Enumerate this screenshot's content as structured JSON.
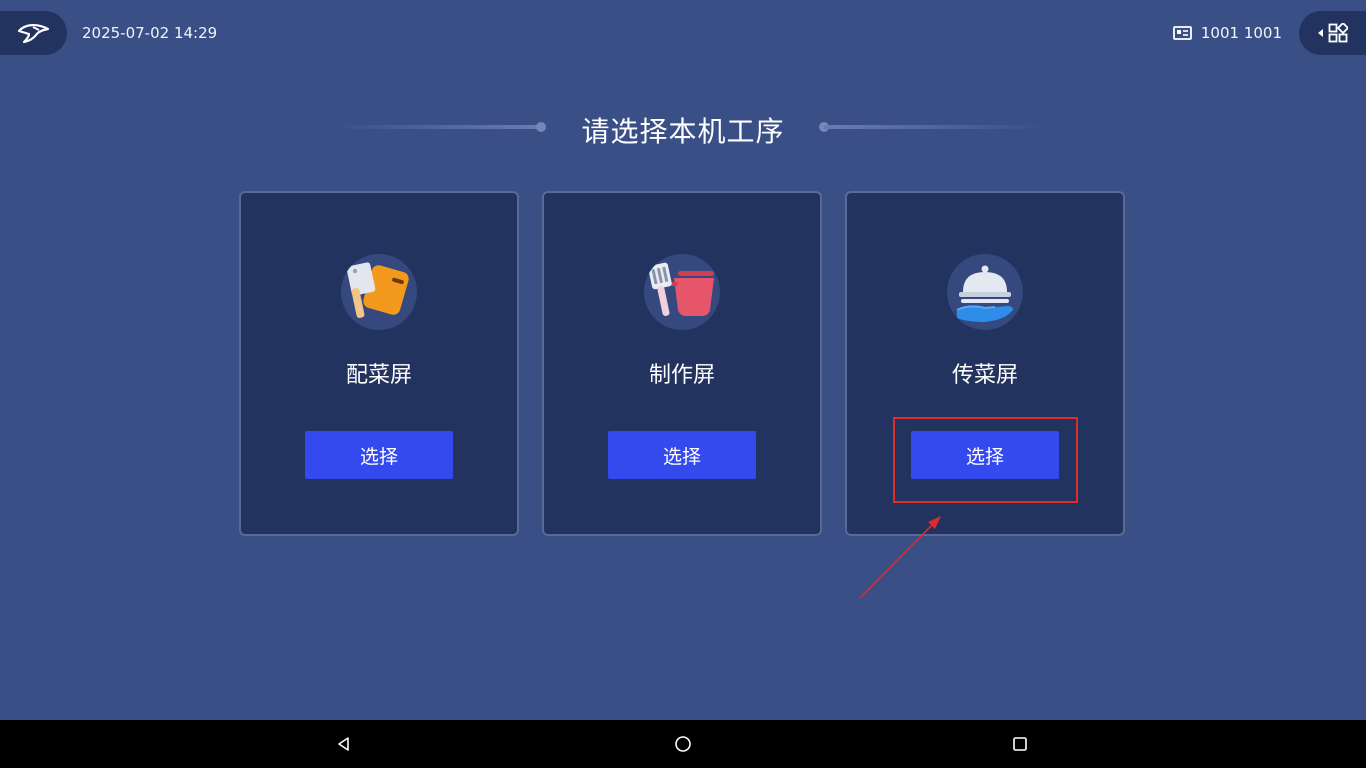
{
  "header": {
    "datetime": "2025-07-02 14:29",
    "station": "1001 1001",
    "back_icon": "bird-logo-back-icon",
    "station_icon": "id-card-icon",
    "menu_icon": "grid-menu-icon"
  },
  "title": "请选择本机工序",
  "cards": [
    {
      "label": "配菜屏",
      "button": "选择",
      "icon": "cleaver-board-icon"
    },
    {
      "label": "制作屏",
      "button": "选择",
      "icon": "spatula-pot-icon"
    },
    {
      "label": "传菜屏",
      "button": "选择",
      "icon": "cloche-hand-icon"
    }
  ],
  "annotation": {
    "color": "#e02b2b",
    "target": "cards.2.button"
  },
  "colors": {
    "background": "#3a4f86",
    "card": "#22335f",
    "button": "#3449ee",
    "navbar": "#000000"
  },
  "navbar": {
    "back_icon": "triangle-back-icon",
    "home_icon": "circle-home-icon",
    "recents_icon": "square-recents-icon"
  }
}
